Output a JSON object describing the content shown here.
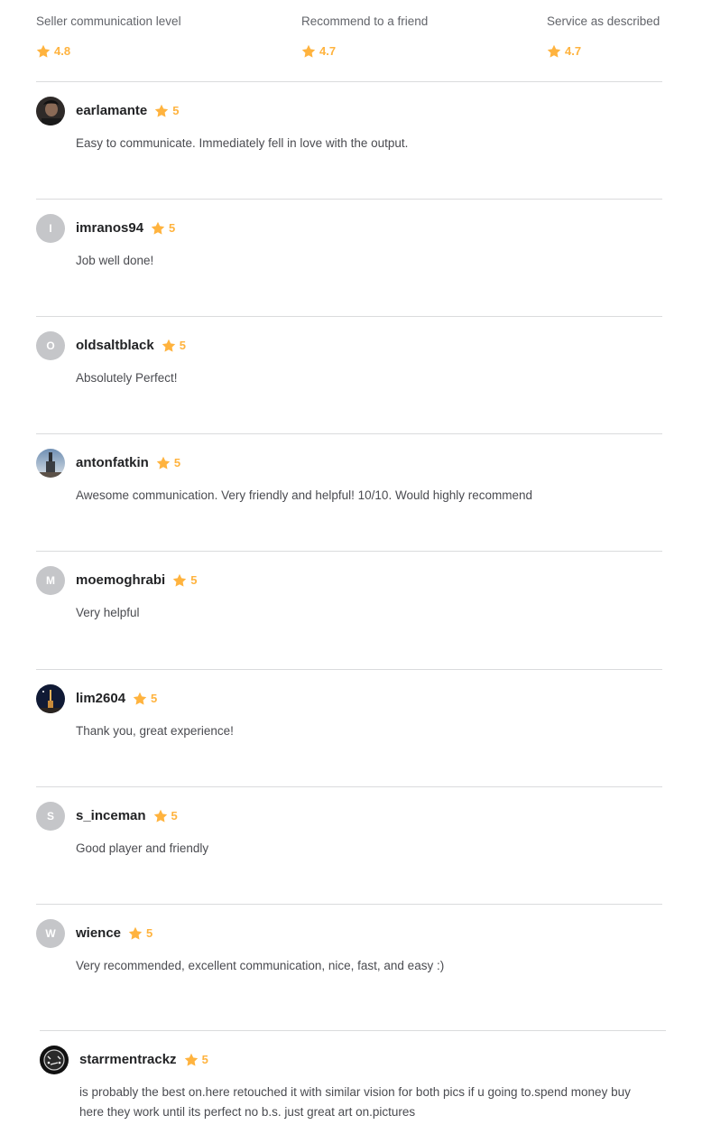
{
  "summary": [
    {
      "label": "Seller communication level",
      "rating": "4.8"
    },
    {
      "label": "Recommend to a friend",
      "rating": "4.7"
    },
    {
      "label": "Service as described",
      "rating": "4.7"
    }
  ],
  "colors": {
    "star": "#ffb33e",
    "divider": "#dadbdd",
    "avatar_placeholder": "#c5c6c9",
    "username": "#222325",
    "text": "#4a4b50"
  },
  "reviews": [
    {
      "username": "earlamante",
      "avatar": "photo",
      "rating": "5",
      "text": "Easy to communicate. Immediately fell in love with the output."
    },
    {
      "username": "imranos94",
      "avatar": "I",
      "rating": "5",
      "text": "Job well done!"
    },
    {
      "username": "oldsaltblack",
      "avatar": "O",
      "rating": "5",
      "text": "Absolutely Perfect!"
    },
    {
      "username": "antonfatkin",
      "avatar": "photo",
      "rating": "5",
      "text": "Awesome communication. Very friendly and helpful! 10/10. Would highly recommend"
    },
    {
      "username": "moemoghrabi",
      "avatar": "M",
      "rating": "5",
      "text": "Very helpful"
    },
    {
      "username": "lim2604",
      "avatar": "photo",
      "rating": "5",
      "text": "Thank you, great experience!"
    },
    {
      "username": "s_inceman",
      "avatar": "S",
      "rating": "5",
      "text": "Good player and friendly"
    },
    {
      "username": "wience",
      "avatar": "W",
      "rating": "5",
      "text": "Very recommended, excellent communication, nice, fast, and easy :)"
    },
    {
      "username": "starrmentrackz",
      "avatar": "photo",
      "rating": "5",
      "text": "is probably the best on.here retouched it with similar vision for both pics if u going to.spend money buy here they work until its perfect no b.s. just great art on.pictures"
    }
  ]
}
